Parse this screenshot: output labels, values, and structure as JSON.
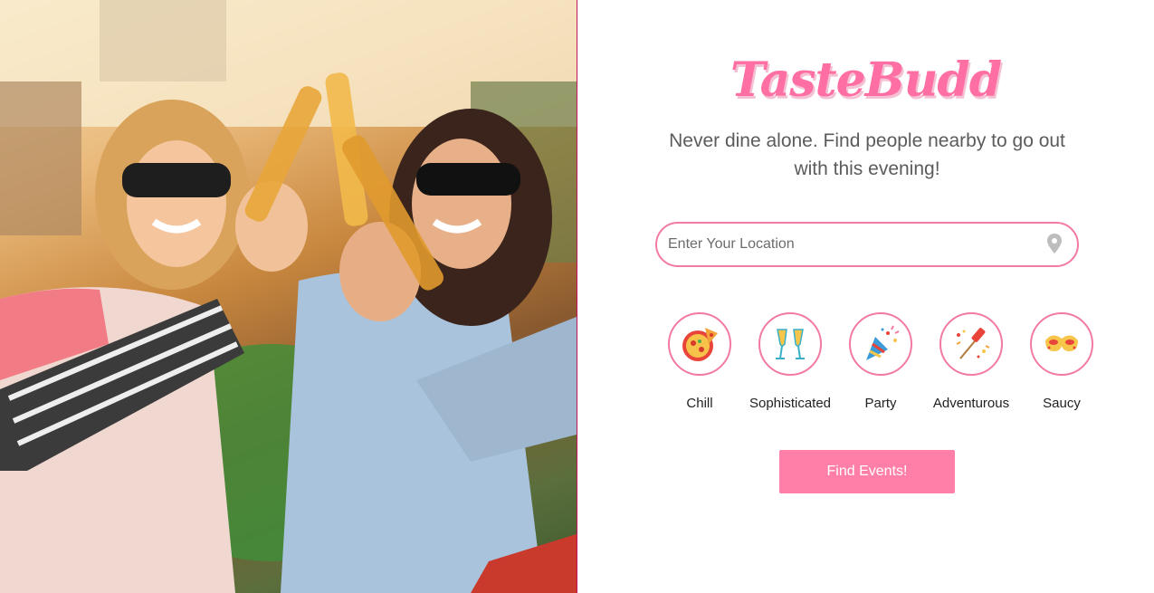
{
  "app": {
    "logo_text": "TasteBudd",
    "tagline": "Never dine alone. Find people nearby to go out with this evening!"
  },
  "search": {
    "placeholder": "Enter Your Location",
    "value": ""
  },
  "moods": [
    {
      "label": "Chill",
      "icon": "pizza-icon"
    },
    {
      "label": "Sophisticated",
      "icon": "champagne-glasses-icon"
    },
    {
      "label": "Party",
      "icon": "party-popper-icon"
    },
    {
      "label": "Adventurous",
      "icon": "firework-rocket-icon"
    },
    {
      "label": "Saucy",
      "icon": "masquerade-mask-icon"
    }
  ],
  "actions": {
    "find_label": "Find Events!"
  },
  "colors": {
    "accent": "#ff7fa8",
    "border": "#f27aa3",
    "divider": "#c2185b"
  }
}
